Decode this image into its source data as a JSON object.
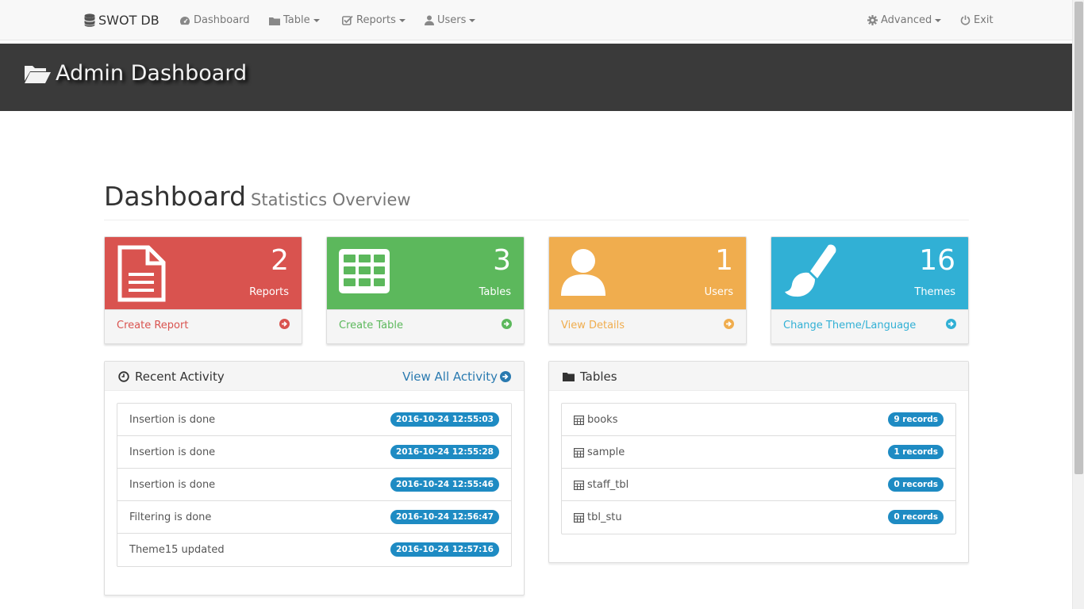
{
  "navbar": {
    "brand": "SWOT DB",
    "dashboard": "Dashboard",
    "table": "Table",
    "reports": "Reports",
    "users": "Users",
    "advanced": "Advanced",
    "exit": "Exit"
  },
  "header": {
    "title": "Admin Dashboard"
  },
  "heading": {
    "title": "Dashboard",
    "subtitle": "Statistics Overview"
  },
  "stats": [
    {
      "count": "2",
      "label": "Reports",
      "link": "Create Report",
      "color": "#d9534f"
    },
    {
      "count": "3",
      "label": "Tables",
      "link": "Create Table",
      "color": "#5cb85c"
    },
    {
      "count": "1",
      "label": "Users",
      "link": "View Details",
      "color": "#f0ad4e"
    },
    {
      "count": "16",
      "label": "Themes",
      "link": "Change Theme/Language",
      "color": "#31b0d5"
    }
  ],
  "activity": {
    "title": "Recent Activity",
    "view_all": "View All Activity",
    "items": [
      {
        "text": "Insertion is done",
        "time": "2016-10-24 12:55:03"
      },
      {
        "text": "Insertion is done",
        "time": "2016-10-24 12:55:28"
      },
      {
        "text": "Insertion is done",
        "time": "2016-10-24 12:55:46"
      },
      {
        "text": "Filtering is done",
        "time": "2016-10-24 12:56:47"
      },
      {
        "text": "Theme15 updated",
        "time": "2016-10-24 12:57:16"
      }
    ]
  },
  "tables": {
    "title": "Tables",
    "items": [
      {
        "name": "books",
        "records": "9 records"
      },
      {
        "name": "sample",
        "records": "1 records"
      },
      {
        "name": "staff_tbl",
        "records": "0 records"
      },
      {
        "name": "tbl_stu",
        "records": "0 records"
      }
    ]
  },
  "icons": [
    "database-icon",
    "dashboard-icon",
    "folder-icon",
    "check-square-icon",
    "user-icon",
    "gear-icon",
    "power-icon",
    "folder-open-icon",
    "file-icon",
    "table-icon",
    "brush-icon",
    "arrow-circle-right-icon",
    "clock-icon"
  ]
}
